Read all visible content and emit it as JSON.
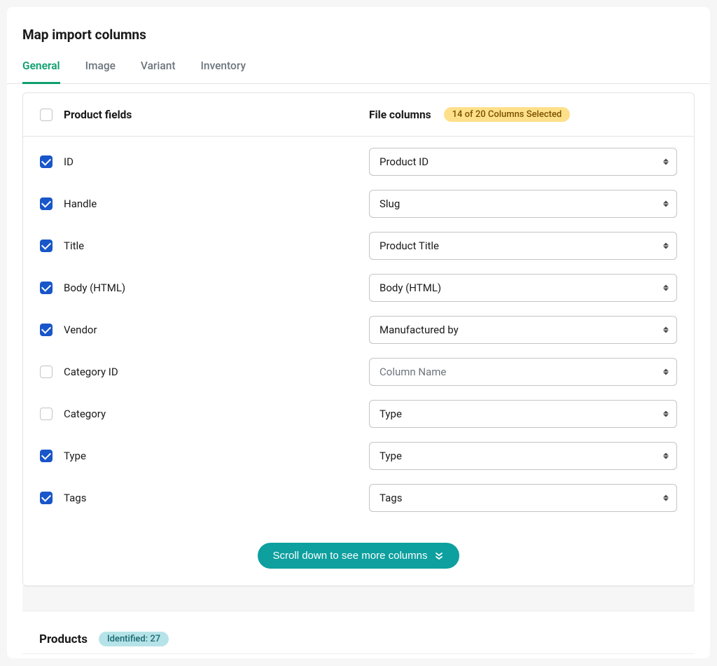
{
  "page": {
    "title": "Map import columns"
  },
  "tabs": [
    {
      "label": "General",
      "active": true
    },
    {
      "label": "Image",
      "active": false
    },
    {
      "label": "Variant",
      "active": false
    },
    {
      "label": "Inventory",
      "active": false
    }
  ],
  "card": {
    "product_fields_label": "Product fields",
    "file_columns_label": "File columns",
    "selection_badge": "14 of 20 Columns Selected",
    "scroll_button_label": "Scroll down to see more columns",
    "placeholder": "Column Name"
  },
  "rows": [
    {
      "checked": true,
      "field": "ID",
      "placeholder": false,
      "value": "Product ID"
    },
    {
      "checked": true,
      "field": "Handle",
      "placeholder": false,
      "value": "Slug"
    },
    {
      "checked": true,
      "field": "Title",
      "placeholder": false,
      "value": "Product Title"
    },
    {
      "checked": true,
      "field": "Body (HTML)",
      "placeholder": false,
      "value": "Body (HTML)"
    },
    {
      "checked": true,
      "field": "Vendor",
      "placeholder": false,
      "value": "Manufactured by"
    },
    {
      "checked": false,
      "field": "Category ID",
      "placeholder": true,
      "value": "Column Name"
    },
    {
      "checked": false,
      "field": "Category",
      "placeholder": false,
      "value": "Type"
    },
    {
      "checked": true,
      "field": "Type",
      "placeholder": false,
      "value": "Type"
    },
    {
      "checked": true,
      "field": "Tags",
      "placeholder": false,
      "value": "Tags"
    }
  ],
  "products": {
    "title": "Products",
    "identified_badge": "Identified: 27"
  }
}
